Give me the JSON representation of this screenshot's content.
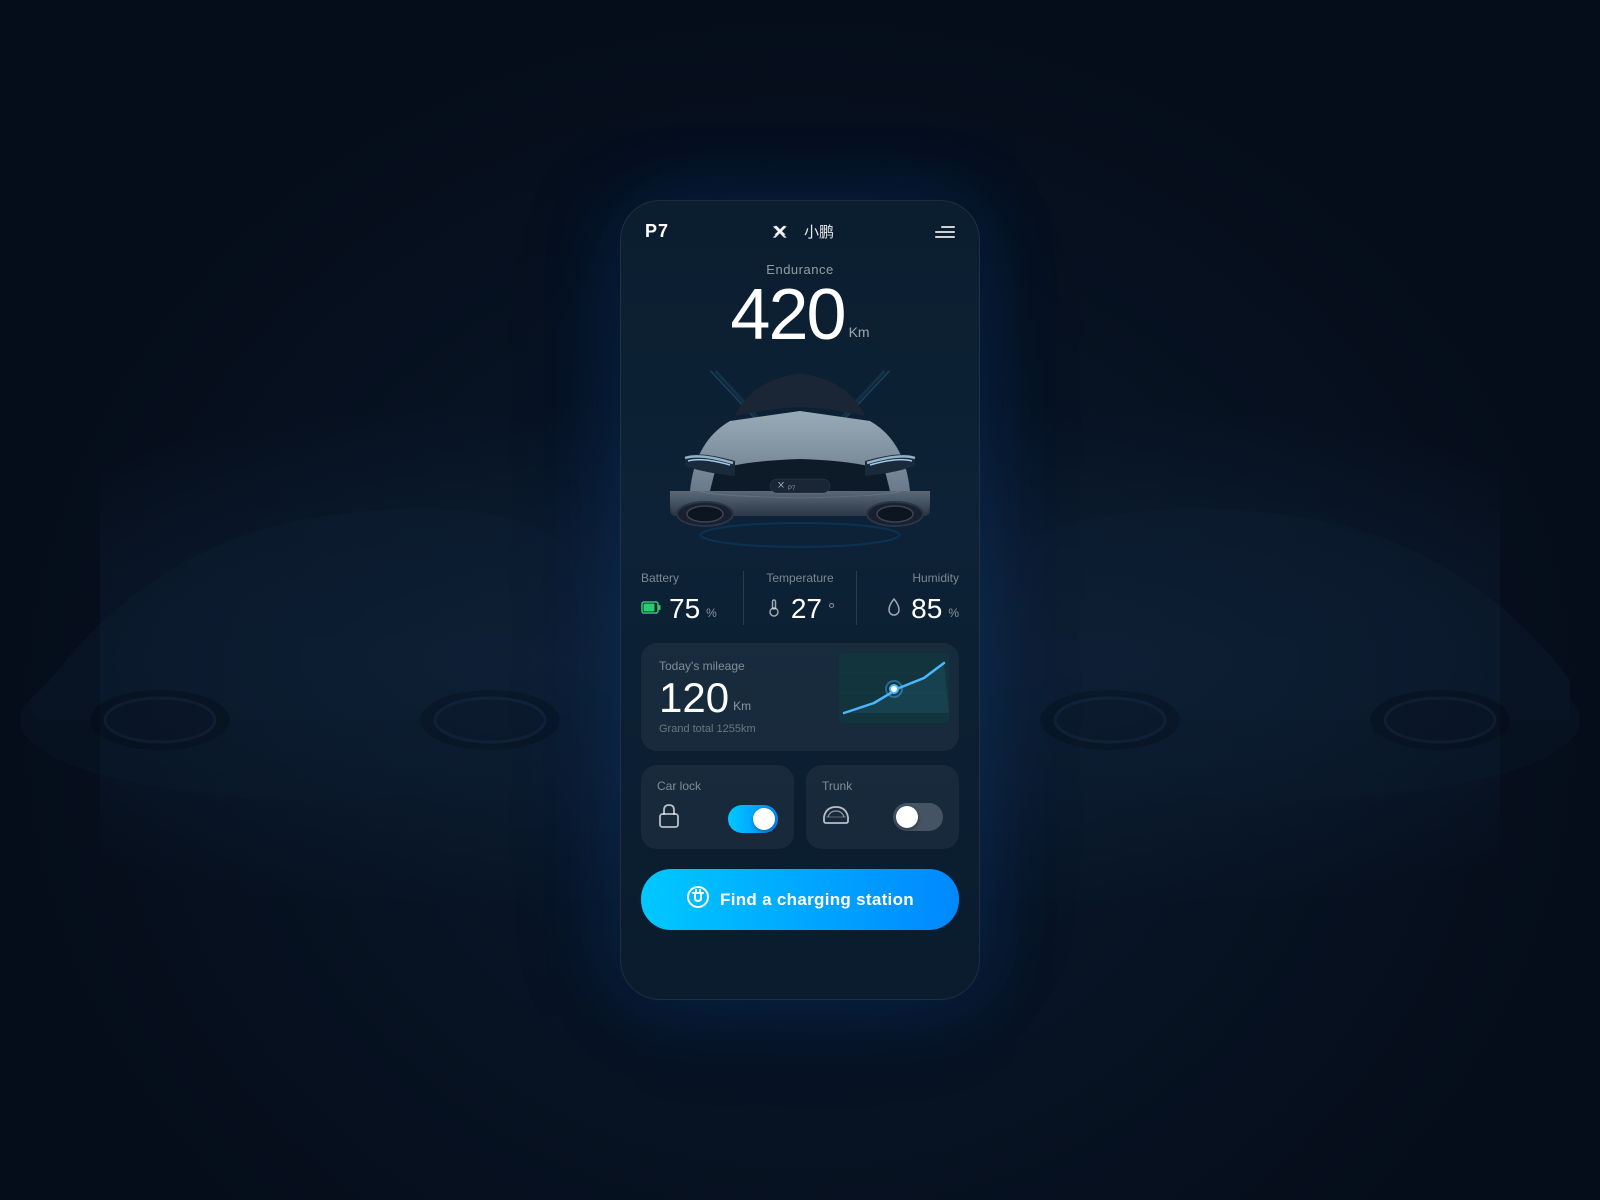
{
  "header": {
    "model": "P7",
    "brand_text": "小鹏",
    "menu_label": "menu"
  },
  "endurance": {
    "label": "Endurance",
    "value": "420",
    "unit": "Km"
  },
  "stats": {
    "battery": {
      "label": "Battery",
      "value": "75",
      "unit": "%"
    },
    "temperature": {
      "label": "Temperature",
      "value": "27",
      "unit": "°"
    },
    "humidity": {
      "label": "Humidity",
      "value": "85",
      "unit": "%"
    }
  },
  "mileage": {
    "label": "Today's mileage",
    "value": "120",
    "unit": "Km",
    "total_label": "Grand total 1255km"
  },
  "controls": {
    "car_lock": {
      "label": "Car lock",
      "state": "on"
    },
    "trunk": {
      "label": "Trunk",
      "state": "off"
    }
  },
  "charging_btn": {
    "label": "Find a charging station"
  }
}
